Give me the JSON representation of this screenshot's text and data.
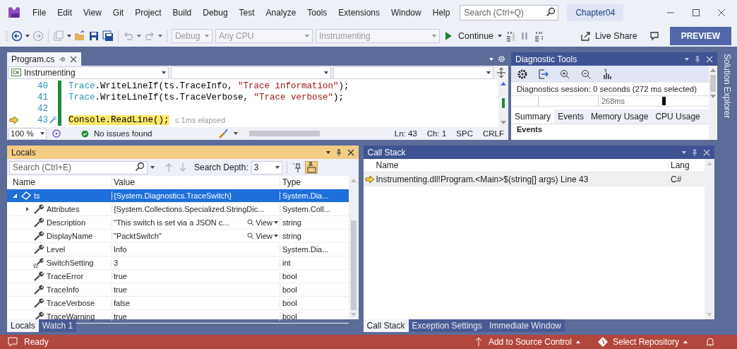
{
  "menu": [
    "File",
    "Edit",
    "View",
    "Git",
    "Project",
    "Build",
    "Debug",
    "Test",
    "Analyze",
    "Tools",
    "Extensions",
    "Window",
    "Help"
  ],
  "search": {
    "placeholder": "Search (Ctrl+Q)"
  },
  "solution_name": "Chapter04",
  "toolbar": {
    "configuration": "Debug",
    "platform": "Any CPU",
    "startup": "Instrumenting",
    "continue": "Continue",
    "live_share": "Live Share",
    "preview": "PREVIEW"
  },
  "editor": {
    "tabs": [
      {
        "label": "Program.cs",
        "selected": true
      }
    ],
    "project": "Instrumenting",
    "lines": [
      {
        "number": "40",
        "current": false,
        "tokens": [
          {
            "kind": "type",
            "text": "Trace"
          },
          {
            "kind": "plain",
            "text": ".WriteLineIf(ts.TraceInfo, "
          },
          {
            "kind": "string",
            "text": "\"Trace information\""
          },
          {
            "kind": "plain",
            "text": ");"
          }
        ]
      },
      {
        "number": "41",
        "current": false,
        "tokens": [
          {
            "kind": "type",
            "text": "Trace"
          },
          {
            "kind": "plain",
            "text": ".WriteLineIf(ts.TraceVerbose, "
          },
          {
            "kind": "string",
            "text": "\"Trace verbose\""
          },
          {
            "kind": "plain",
            "text": ");"
          }
        ]
      },
      {
        "number": "42",
        "current": false
      },
      {
        "number": "43",
        "current": true,
        "tokens": [
          {
            "kind": "plain",
            "text": "Console.ReadLine();"
          }
        ]
      }
    ],
    "elapsed": "≤ 1ms elapsed",
    "zoom": "100 %",
    "issues": "No issues found",
    "ln": "Ln: 43",
    "ch": "Ch: 1",
    "spc": "SPC",
    "crlf": "CRLF"
  },
  "diagnostics": {
    "title": "Diagnostic Tools",
    "session": "Diagnostics session: 0 seconds (272 ms selected)",
    "timeline_label": "268ms",
    "tabs": [
      {
        "label": "Summary",
        "selected": true
      },
      {
        "label": "Events",
        "selected": false
      },
      {
        "label": "Memory Usage",
        "selected": false
      },
      {
        "label": "CPU Usage",
        "selected": false
      }
    ],
    "section": "Events"
  },
  "solution_explorer": "Solution Explorer",
  "locals": {
    "title": "Locals",
    "search": {
      "placeholder": "Search (Ctrl+E)"
    },
    "search_depth_label": "Search Depth:",
    "search_depth": "3",
    "columns": [
      "Name",
      "Value",
      "Type"
    ],
    "rows": [
      {
        "name": "ts",
        "value": "{System.Diagnostics.TraceSwitch}",
        "type": "System.Dia...",
        "kind": "object",
        "selected": true,
        "expanded": true,
        "children": [
          {
            "name": "Attributes",
            "value": "{System.Collections.Specialized.StringDic...",
            "type": "System.Coll...",
            "kind": "property",
            "selected": false,
            "expanded": false
          },
          {
            "name": "Description",
            "value": "\"This switch is set via a JSON c...",
            "visualizer": "View",
            "type": "string",
            "kind": "property",
            "selected": false
          },
          {
            "name": "DisplayName",
            "value": "\"PacktSwitch\"",
            "visualizer": "View",
            "type": "string",
            "kind": "property",
            "selected": false
          },
          {
            "name": "Level",
            "value": "Info",
            "type": "System.Dia...",
            "kind": "property",
            "selected": false
          },
          {
            "name": "SwitchSetting",
            "value": "3",
            "type": "int",
            "kind": "setting",
            "selected": false
          },
          {
            "name": "TraceError",
            "value": "true",
            "type": "bool",
            "kind": "property",
            "selected": false
          },
          {
            "name": "TraceInfo",
            "value": "true",
            "type": "bool",
            "kind": "property",
            "selected": false
          },
          {
            "name": "TraceVerbose",
            "value": "false",
            "type": "bool",
            "kind": "property",
            "selected": false
          },
          {
            "name": "TraceWarning",
            "value": "true",
            "type": "bool",
            "kind": "property",
            "selected": false
          }
        ]
      }
    ],
    "tabs": [
      {
        "label": "Locals",
        "selected": true
      },
      {
        "label": "Watch 1",
        "selected": false
      }
    ]
  },
  "call_stack": {
    "title": "Call Stack",
    "columns": [
      "Name",
      "Lang"
    ],
    "rows": [
      {
        "name": "Instrumenting.dll!Program.<Main>$(string[] args) Line 43",
        "language": "C#",
        "current": true
      }
    ],
    "tabs": [
      {
        "label": "Call Stack",
        "selected": true
      },
      {
        "label": "Exception Settings",
        "selected": false
      },
      {
        "label": "Immediate Window",
        "selected": false
      }
    ]
  },
  "status": {
    "text": "Ready",
    "source_control": "Add to Source Control",
    "repository": "Select Repository"
  }
}
